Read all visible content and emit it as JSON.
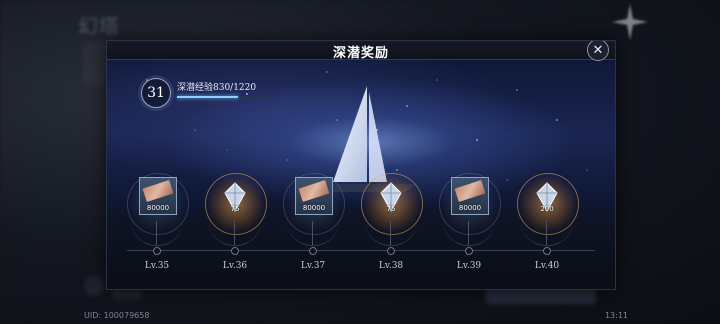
{
  "background": {
    "logo_text": "幻塔",
    "uid": "UID: 100079658",
    "time": "13:11"
  },
  "modal": {
    "title": "深潜奖励",
    "close_icon": "close-icon",
    "level": "31",
    "exp_label": "深潜经验830/1220",
    "exp_current": 830,
    "exp_max": 1220
  },
  "rewards": [
    {
      "level": "Lv.35",
      "qty": "80000",
      "icon": "ticket-icon",
      "style": "blue"
    },
    {
      "level": "Lv.36",
      "qty": "75",
      "icon": "crystal-icon",
      "style": "gold"
    },
    {
      "level": "Lv.37",
      "qty": "80000",
      "icon": "ticket-icon",
      "style": "blue"
    },
    {
      "level": "Lv.38",
      "qty": "75",
      "icon": "crystal-icon",
      "style": "gold"
    },
    {
      "level": "Lv.39",
      "qty": "80000",
      "icon": "ticket-icon",
      "style": "blue"
    },
    {
      "level": "Lv.40",
      "qty": "200",
      "icon": "crystal-icon",
      "style": "gold"
    }
  ],
  "colors": {
    "accent_gold": "#e8a85a",
    "exp_fill": "#8fd0ff"
  }
}
